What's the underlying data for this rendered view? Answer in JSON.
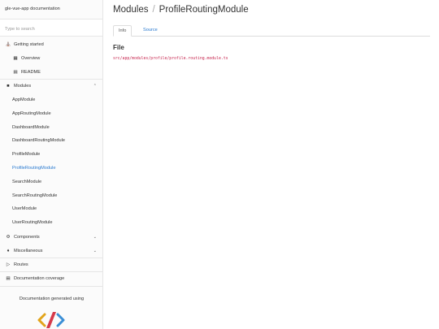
{
  "sidebar": {
    "title": "gle-vue-app documentation",
    "search_placeholder": "Type to search",
    "getting_started": {
      "icon": "home-icon",
      "label": "Getting started"
    },
    "overview": {
      "icon": "grid-icon",
      "label": "Overview"
    },
    "readme": {
      "icon": "file-icon",
      "label": "README"
    },
    "modules": {
      "icon": "archive-icon",
      "label": "Modules",
      "chevron": "chevron-up-icon"
    },
    "module_items": [
      "AppModule",
      "AppRoutingModule",
      "DashboardModule",
      "DashboardRoutingModule",
      "ProfileModule",
      "ProfileRoutingModule",
      "SearchModule",
      "SearchRoutingModule",
      "UserModule",
      "UserRoutingModule"
    ],
    "active_module": "ProfileRoutingModule",
    "components": {
      "icon": "cogs-icon",
      "label": "Components",
      "chevron": "chevron-down-icon"
    },
    "miscellaneous": {
      "icon": "cubes-icon",
      "label": "Miscellaneous",
      "chevron": "chevron-down-icon"
    },
    "routes": {
      "icon": "routes-icon",
      "label": "Routes"
    },
    "coverage": {
      "icon": "list-icon",
      "label": "Documentation coverage"
    },
    "generated_text": "Documentation generated using",
    "logo": "compodoc-logo"
  },
  "main": {
    "breadcrumb_root": "Modules",
    "breadcrumb_separator": "/",
    "breadcrumb_current": "ProfileRoutingModule",
    "tabs": [
      {
        "label": "Info",
        "active": true
      },
      {
        "label": "Source",
        "active": false
      }
    ],
    "file_heading": "File",
    "file_path": "src/app/modules/profile/profile.routing.module.ts"
  },
  "colors": {
    "link": "#2a7ad0",
    "code": "#c7254e",
    "sidebar_bg": "#fbfbfb"
  }
}
